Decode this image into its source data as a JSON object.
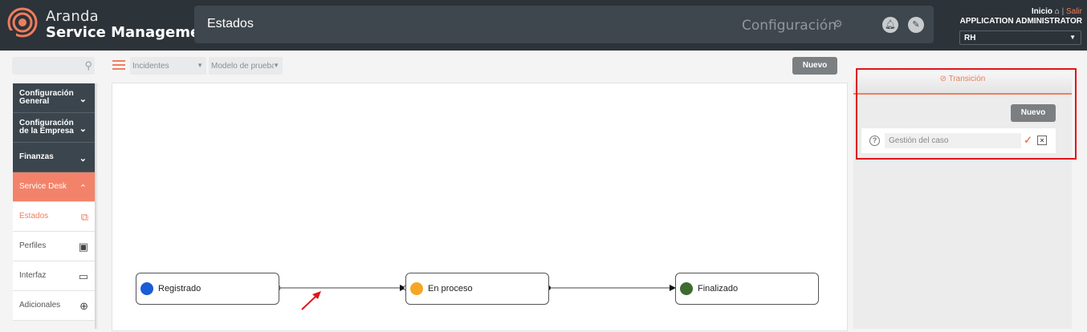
{
  "brand": {
    "line1": "Aranda",
    "line2": "Service Management"
  },
  "titlebar": {
    "title": "Estados",
    "config": "Configuración"
  },
  "user": {
    "home": "Inicio",
    "logout": "Salir",
    "role": "APPLICATION ADMINISTRATOR",
    "project": "RH"
  },
  "sidebar": {
    "items": [
      {
        "label": "Configuración General"
      },
      {
        "label": "Configuración de la Empresa"
      },
      {
        "label": "Finanzas"
      },
      {
        "label": "Service Desk"
      },
      {
        "label": "Estados"
      },
      {
        "label": "Perfiles"
      },
      {
        "label": "Interfaz"
      },
      {
        "label": "Adicionales"
      }
    ]
  },
  "toolbar": {
    "case_type": "Incidentes",
    "model": "Modelo de prueba",
    "new_label": "Nuevo"
  },
  "workflow": {
    "states": [
      {
        "label": "Registrado",
        "color": "#1a5bd6"
      },
      {
        "label": "En proceso",
        "color": "#f5a623"
      },
      {
        "label": "Finalizado",
        "color": "#3e6b2f"
      }
    ]
  },
  "panel": {
    "tab": "Transición",
    "new_label": "Nuevo",
    "field_value": "Gestión del caso"
  },
  "colors": {
    "accent": "#f07d5d",
    "dark": "#2c3339",
    "highlight": "#e0141b"
  }
}
